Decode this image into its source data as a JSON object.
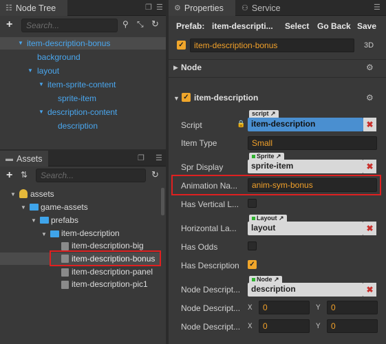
{
  "node_tree": {
    "tab_label": "Node Tree",
    "search_placeholder": "Search...",
    "items": [
      {
        "label": "item-description-bonus"
      },
      {
        "label": "background"
      },
      {
        "label": "layout"
      },
      {
        "label": "item-sprite-content"
      },
      {
        "label": "sprite-item"
      },
      {
        "label": "description-content"
      },
      {
        "label": "description"
      }
    ]
  },
  "assets": {
    "tab_label": "Assets",
    "search_placeholder": "Search...",
    "items": [
      {
        "label": "assets"
      },
      {
        "label": "game-assets"
      },
      {
        "label": "prefabs"
      },
      {
        "label": "item-description"
      },
      {
        "label": "item-description-big"
      },
      {
        "label": "item-description-bonus"
      },
      {
        "label": "item-description-panel"
      },
      {
        "label": "item-description-pic1"
      }
    ]
  },
  "properties": {
    "tab_label": "Properties",
    "service_tab_label": "Service",
    "prefab_label": "Prefab:",
    "prefab_name": "item-descripti...",
    "select_label": "Select",
    "go_back_label": "Go Back",
    "save_label": "Save",
    "node_name": "item-description-bonus",
    "mode_label": "3D",
    "node_section": "Node",
    "component_title": "item-description",
    "rows": {
      "script": {
        "label": "Script",
        "tag": "script",
        "value": "item-description"
      },
      "item_type": {
        "label": "Item Type",
        "value": "Small"
      },
      "spr_display": {
        "label": "Spr Display",
        "tag": "Sprite",
        "value": "sprite-item"
      },
      "animation_name": {
        "label": "Animation Na...",
        "value": "anim-sym-bonus"
      },
      "has_vertical": {
        "label": "Has Vertical L...",
        "checked": false
      },
      "horizontal": {
        "label": "Horizontal La...",
        "tag": "Layout",
        "value": "layout"
      },
      "has_odds": {
        "label": "Has Odds",
        "checked": false
      },
      "has_description": {
        "label": "Has Description",
        "checked": true
      },
      "node_descript_1": {
        "label": "Node Descript...",
        "tag": "Node",
        "value": "description"
      },
      "node_descript_2": {
        "label": "Node Descript...",
        "x_label": "X",
        "x": "0",
        "y_label": "Y",
        "y": "0"
      },
      "node_descript_3": {
        "label": "Node Descript...",
        "x_label": "X",
        "x": "0",
        "y_label": "Y",
        "y": "0"
      }
    }
  },
  "colors": {
    "accent_blue": "#4aa7ef",
    "highlight_red": "#e02020",
    "value_orange": "#f2a12a"
  }
}
